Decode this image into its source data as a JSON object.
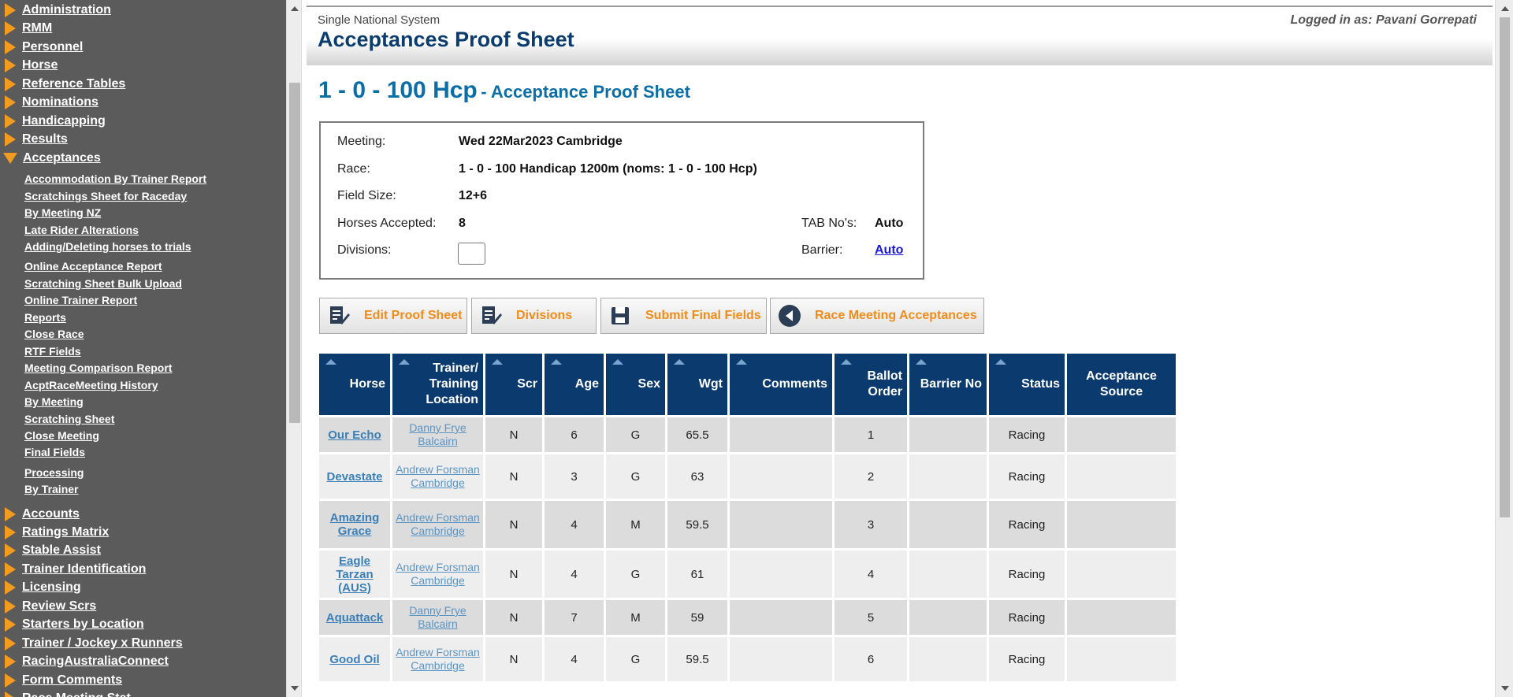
{
  "sidebar": {
    "top_items_1": [
      {
        "label": "Administration",
        "expanded": false
      },
      {
        "label": "RMM",
        "expanded": false
      },
      {
        "label": "Personnel",
        "expanded": false
      },
      {
        "label": "Horse",
        "expanded": false
      },
      {
        "label": "Reference Tables",
        "expanded": false
      },
      {
        "label": "Nominations",
        "expanded": false
      },
      {
        "label": "Handicapping",
        "expanded": false
      },
      {
        "label": "Results",
        "expanded": false
      },
      {
        "label": "Acceptances",
        "expanded": true
      }
    ],
    "sub_items": [
      "Accommodation By Trainer Report",
      "Scratchings Sheet for Raceday",
      "By Meeting NZ",
      "Late Rider Alterations",
      "Adding/Deleting horses to trials",
      "Online Acceptance Report",
      "Scratching Sheet Bulk Upload",
      "Online Trainer Report",
      "Reports",
      "Close Race",
      "RTF Fields",
      "Meeting Comparison Report",
      "AcptRaceMeeting History",
      "By Meeting",
      "Scratching Sheet",
      "Close Meeting",
      "Final Fields",
      "Processing",
      "By Trainer"
    ],
    "top_items_2": [
      {
        "label": "Accounts"
      },
      {
        "label": "Ratings Matrix"
      },
      {
        "label": "Stable Assist"
      },
      {
        "label": "Trainer Identification"
      },
      {
        "label": "Licensing"
      },
      {
        "label": "Review Scrs"
      },
      {
        "label": "Starters by Location"
      },
      {
        "label": "Trainer / Jockey x Runners"
      },
      {
        "label": "RacingAustraliaConnect"
      },
      {
        "label": "Form Comments"
      },
      {
        "label": "Race Meeting Stat"
      }
    ]
  },
  "header": {
    "system": "Single National System",
    "title": "Acceptances Proof Sheet",
    "logged_in": "Logged in as: Pavani Gorrepati"
  },
  "race": {
    "name": "1 - 0 - 100 Hcp",
    "subtitle": "- Acceptance Proof Sheet"
  },
  "info": {
    "meeting_label": "Meeting:",
    "meeting_value": "Wed 22Mar2023 Cambridge",
    "race_label": "Race:",
    "race_value": "1 - 0 - 100 Handicap 1200m (noms: 1 - 0 - 100 Hcp)",
    "field_size_label": "Field Size:",
    "field_size_value": "12+6",
    "horses_accepted_label": "Horses Accepted:",
    "horses_accepted_value": "8",
    "divisions_label": "Divisions:",
    "tab_label": "TAB No's:",
    "tab_value": "Auto",
    "barrier_label": "Barrier:",
    "barrier_value": "Auto"
  },
  "actions": {
    "edit": "Edit Proof Sheet",
    "divisions": "Divisions",
    "submit": "Submit Final Fields",
    "race_meeting": "Race Meeting Acceptances"
  },
  "table": {
    "headers": [
      "Horse",
      "Trainer/ Training Location",
      "Scr",
      "Age",
      "Sex",
      "Wgt",
      "Comments",
      "Ballot Order",
      "Barrier No",
      "Status",
      "Acceptance Source"
    ],
    "rows": [
      {
        "horse": "Our Echo",
        "trainer": "Danny Frye Balcairn",
        "scr": "N",
        "age": "6",
        "sex": "G",
        "wgt": "65.5",
        "comments": "",
        "ballot": "1",
        "barrier": "",
        "status": "Racing",
        "source": ""
      },
      {
        "horse": "Devastate",
        "trainer": "Andrew Forsman Cambridge",
        "scr": "N",
        "age": "3",
        "sex": "G",
        "wgt": "63",
        "comments": "",
        "ballot": "2",
        "barrier": "",
        "status": "Racing",
        "source": ""
      },
      {
        "horse": "Amazing Grace",
        "trainer": "Andrew Forsman Cambridge",
        "scr": "N",
        "age": "4",
        "sex": "M",
        "wgt": "59.5",
        "comments": "",
        "ballot": "3",
        "barrier": "",
        "status": "Racing",
        "source": ""
      },
      {
        "horse": "Eagle Tarzan (AUS)",
        "trainer": "Andrew Forsman Cambridge",
        "scr": "N",
        "age": "4",
        "sex": "G",
        "wgt": "61",
        "comments": "",
        "ballot": "4",
        "barrier": "",
        "status": "Racing",
        "source": ""
      },
      {
        "horse": "Aquattack",
        "trainer": "Danny Frye Balcairn",
        "scr": "N",
        "age": "7",
        "sex": "M",
        "wgt": "59",
        "comments": "",
        "ballot": "5",
        "barrier": "",
        "status": "Racing",
        "source": ""
      },
      {
        "horse": "Good Oil",
        "trainer": "Andrew Forsman Cambridge",
        "scr": "N",
        "age": "4",
        "sex": "G",
        "wgt": "59.5",
        "comments": "",
        "ballot": "6",
        "barrier": "",
        "status": "Racing",
        "source": ""
      }
    ]
  },
  "colors": {
    "sidebar_bg": "#5b5b5b",
    "accent_orange": "#f39b1f",
    "header_navy": "#0b3a6e",
    "link_blue": "#3a7fb8"
  }
}
